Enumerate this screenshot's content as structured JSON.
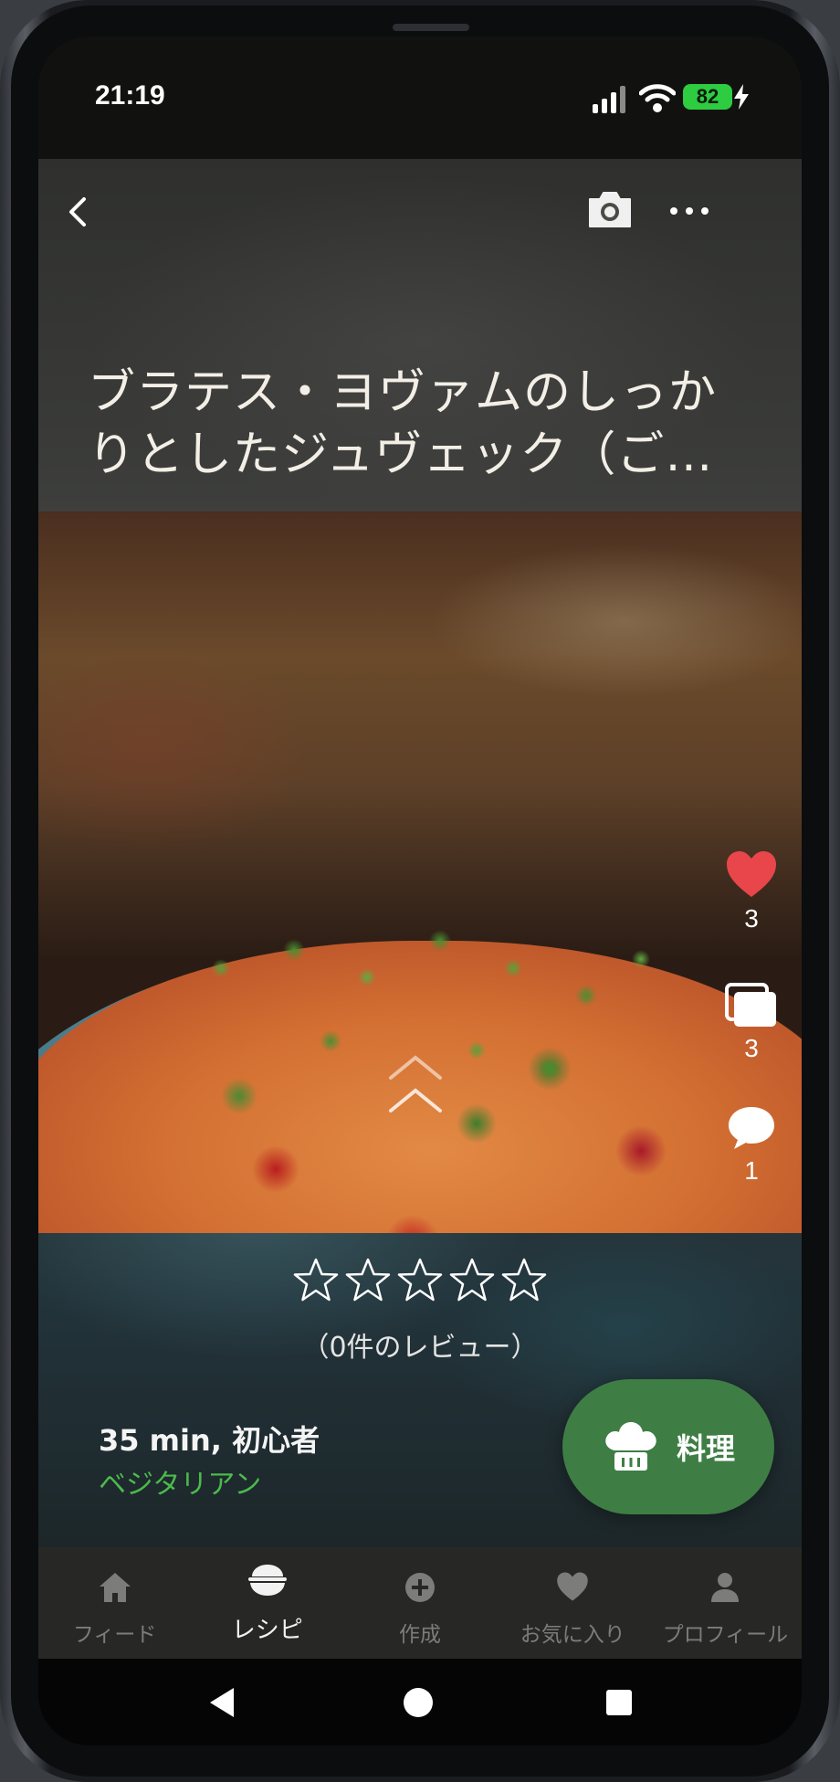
{
  "status_bar": {
    "time": "21:19",
    "battery_level": "82",
    "icons": [
      "cellular-signal-icon",
      "wifi-icon",
      "battery-icon",
      "charging-bolt-icon"
    ]
  },
  "top_nav": {
    "icons": [
      "back-chevron-icon",
      "camera-icon",
      "more-dots-icon"
    ]
  },
  "recipe": {
    "title": "ブラテス・ヨヴァムのしっかりとしたジュヴェック（ご…",
    "rating_stars": 0,
    "rating_max": 5,
    "review_count_label": "（0件のレビュー）",
    "meta": "35 min, 初心者",
    "diet": "ベジタリアン"
  },
  "side_actions": {
    "likes": "3",
    "collections": "3",
    "comments": "1",
    "icons": [
      "heart-icon",
      "collections-icon",
      "comment-icon"
    ]
  },
  "cook_button": {
    "label": "料理",
    "icon": "chef-hat-icon"
  },
  "tab_bar": {
    "items": [
      {
        "label": "フィード",
        "icon": "home-icon"
      },
      {
        "label": "レシピ",
        "icon": "rice-bowl-icon"
      },
      {
        "label": "作成",
        "icon": "plus-circle-icon"
      },
      {
        "label": "お気に入り",
        "icon": "heart-icon"
      },
      {
        "label": "プロフィール",
        "icon": "person-icon"
      }
    ],
    "active_index": 1
  },
  "colors": {
    "accent_green": "#3e7e45",
    "diet_green": "#4cbb4c",
    "like_red": "#e8464a",
    "battery_green": "#2ecc40"
  }
}
